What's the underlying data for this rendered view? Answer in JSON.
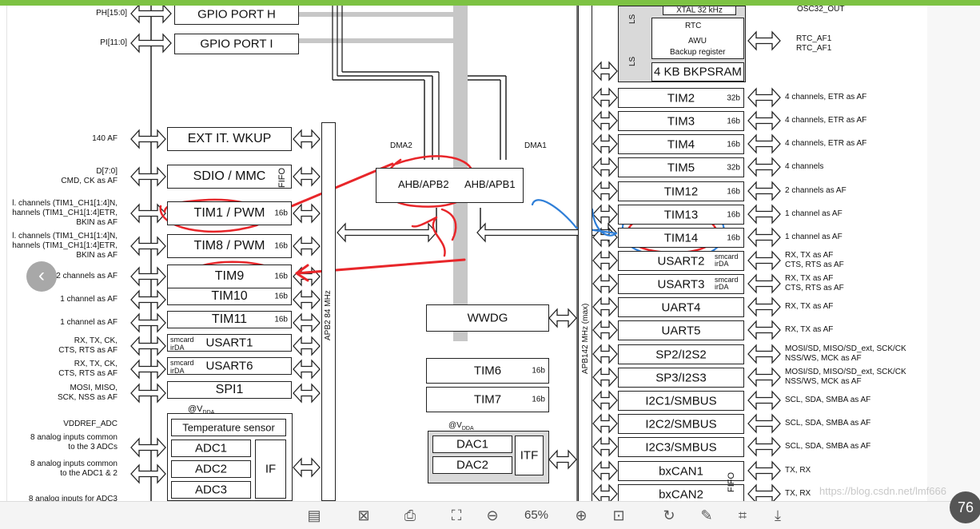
{
  "diagram": {
    "gpio": [
      {
        "port": "GPIO PORT H",
        "pin_label": "PH[15:0]"
      },
      {
        "port": "GPIO PORT I",
        "pin_label": "PI[11:0]"
      }
    ],
    "left_blocks": [
      {
        "name": "EXT IT. WKUP",
        "bits": "",
        "tag": "",
        "label": "140 AF"
      },
      {
        "name": "SDIO / MMC",
        "bits": "",
        "tag": "",
        "label": "D[7:0]\nCMD, CK as AF"
      },
      {
        "name": "TIM1 / PWM",
        "bits": "16b",
        "tag": "",
        "label": "l. channels (TIM1_CH1[1:4]N,\nhannels (TIM1_CH1[1:4]ETR,\nBKIN as AF"
      },
      {
        "name": "TIM8 / PWM",
        "bits": "16b",
        "tag": "",
        "label": "l. channels (TIM1_CH1[1:4]N,\nhannels (TIM1_CH1[1:4]ETR,\nBKIN as AF"
      },
      {
        "name": "TIM9",
        "bits": "16b",
        "tag": "",
        "label": "2 channels as AF"
      },
      {
        "name": "TIM10",
        "bits": "16b",
        "tag": "",
        "label": "1 channel as AF"
      },
      {
        "name": "TIM11",
        "bits": "16b",
        "tag": "",
        "label": "1 channel as AF"
      },
      {
        "name": "USART1",
        "bits": "",
        "tag": "smcard\nirDA",
        "label": "RX, TX, CK,\nCTS, RTS as AF"
      },
      {
        "name": "USART6",
        "bits": "",
        "tag": "smcard\nirDA",
        "label": "RX, TX, CK,\nCTS, RTS as AF"
      },
      {
        "name": "SPI1",
        "bits": "",
        "tag": "",
        "label": "MOSI, MISO,\nSCK, NSS as AF"
      }
    ],
    "fifo": "FIFO",
    "vdda_label": "VDDREF_ADC",
    "at_vdda": "@V",
    "vdda_sub": "DDA",
    "adc_block": {
      "temp": "Temperature sensor",
      "adcs": [
        "ADC1",
        "ADC2",
        "ADC3"
      ],
      "if": "IF"
    },
    "adc_labels": [
      "8 analog inputs common\nto the 3 ADCs",
      "8 analog inputs common\nto the ADC1 & 2",
      "8 analog inputs for ADC3"
    ],
    "apb2_label": "APB2 84 MHz",
    "apb1_label": "APB142  MHz (max)",
    "dma2": "DMA2",
    "dma1": "DMA1",
    "bridge_left": "AHB/APB2",
    "bridge_right": "AHB/APB1",
    "wwdg": "WWDG",
    "tim6": {
      "name": "TIM6",
      "bits": "16b"
    },
    "tim7": {
      "name": "TIM7",
      "bits": "16b"
    },
    "dac": [
      "DAC1",
      "DAC2"
    ],
    "itf": "ITF",
    "rtc": {
      "xtal": "XTAL 32 kHz",
      "title": "RTC",
      "awu": "AWU",
      "backup": "Backup register",
      "ls": "LS",
      "bkpsram": "4 KB BKPSRAM"
    },
    "rtc_labels": {
      "osc": "OSC32_OUT",
      "af": "RTC_AF1\nRTC_AF1"
    },
    "right_blocks": [
      {
        "name": "TIM2",
        "bits": "32b",
        "tag": "",
        "label": "4 channels, ETR as AF"
      },
      {
        "name": "TIM3",
        "bits": "16b",
        "tag": "",
        "label": "4 channels, ETR as AF"
      },
      {
        "name": "TIM4",
        "bits": "16b",
        "tag": "",
        "label": "4 channels, ETR as AF"
      },
      {
        "name": "TIM5",
        "bits": "32b",
        "tag": "",
        "label": "4 channels"
      },
      {
        "name": "TIM12",
        "bits": "16b",
        "tag": "",
        "label": "2 channels as AF"
      },
      {
        "name": "TIM13",
        "bits": "16b",
        "tag": "",
        "label": "1 channel as AF"
      },
      {
        "name": "TIM14",
        "bits": "16b",
        "tag": "",
        "label": "1 channel as AF"
      },
      {
        "name": "USART2",
        "bits": "",
        "tag": "smcard\nirDA",
        "label": "RX, TX as AF\nCTS, RTS as AF"
      },
      {
        "name": "USART3",
        "bits": "",
        "tag": "smcard\nirDA",
        "label": "RX, TX as AF\nCTS, RTS as AF"
      },
      {
        "name": "UART4",
        "bits": "",
        "tag": "",
        "label": "RX, TX as AF"
      },
      {
        "name": "UART5",
        "bits": "",
        "tag": "",
        "label": "RX, TX as AF"
      },
      {
        "name": "SP2/I2S2",
        "bits": "",
        "tag": "",
        "label": "MOSI/SD, MISO/SD_ext, SCK/CK\nNSS/WS, MCK as AF"
      },
      {
        "name": "SP3/I2S3",
        "bits": "",
        "tag": "",
        "label": "MOSI/SD, MISO/SD_ext, SCK/CK\nNSS/WS, MCK as AF"
      },
      {
        "name": "I2C1/SMBUS",
        "bits": "",
        "tag": "",
        "label": "SCL, SDA, SMBA as AF"
      },
      {
        "name": "I2C2/SMBUS",
        "bits": "",
        "tag": "",
        "label": "SCL, SDA, SMBA as AF"
      },
      {
        "name": "I2C3/SMBUS",
        "bits": "",
        "tag": "",
        "label": "SCL, SDA, SMBA as AF"
      },
      {
        "name": "bxCAN1",
        "bits": "",
        "tag": "",
        "label": "TX, RX"
      },
      {
        "name": "bxCAN2",
        "bits": "",
        "tag": "",
        "label": "TX, RX"
      }
    ]
  },
  "viewer": {
    "zoom": "65%",
    "watermark": "https://blog.csdn.net/lmf666",
    "page_badge": "76",
    "nav_prev": "‹",
    "toolbar_icons": [
      "layout-icon",
      "crop-select-icon",
      "translate-icon",
      "fit-page-icon",
      "zoom-out-icon",
      "zoom-in-icon",
      "actual-size-icon",
      "rotate-icon",
      "annotate-icon",
      "crop-icon",
      "download-icon"
    ]
  },
  "colors": {
    "green_bar": "#7dc243",
    "annotation_red": "#e8262a",
    "annotation_blue": "#2f7fd8"
  }
}
